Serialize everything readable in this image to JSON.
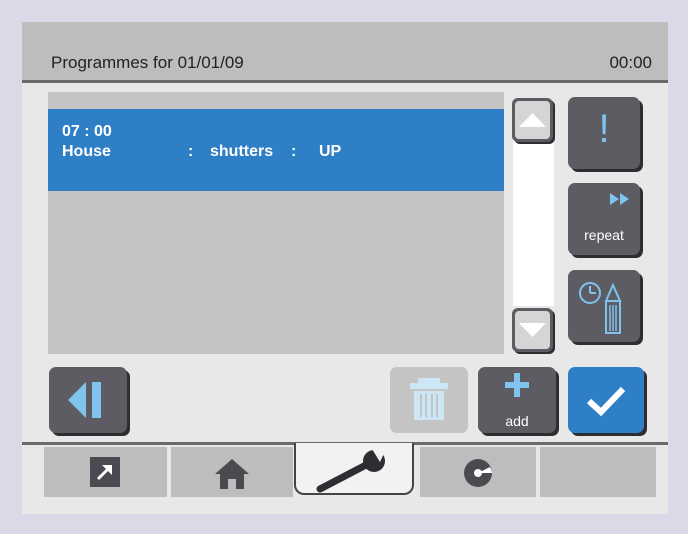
{
  "header": {
    "title": "Programmes for 01/01/09",
    "time": "00:00"
  },
  "programmes": [
    {
      "time": "07 : 00",
      "zone": "House",
      "device": "shutters",
      "action": "UP",
      "sep": ":"
    }
  ],
  "buttons": {
    "alert": "!",
    "repeat_label": "repeat",
    "add_label": "add"
  },
  "colors": {
    "accent": "#2f7fc6",
    "button_dark": "#5c5c62",
    "icon_light_blue": "#7fc3ee"
  },
  "tabs": [
    {
      "name": "shortcut",
      "icon": "arrow-up-right-icon"
    },
    {
      "name": "home",
      "icon": "house-icon"
    },
    {
      "name": "settings",
      "icon": "wrench-icon",
      "active": true
    },
    {
      "name": "media",
      "icon": "disc-icon"
    },
    {
      "name": "empty",
      "icon": ""
    }
  ]
}
